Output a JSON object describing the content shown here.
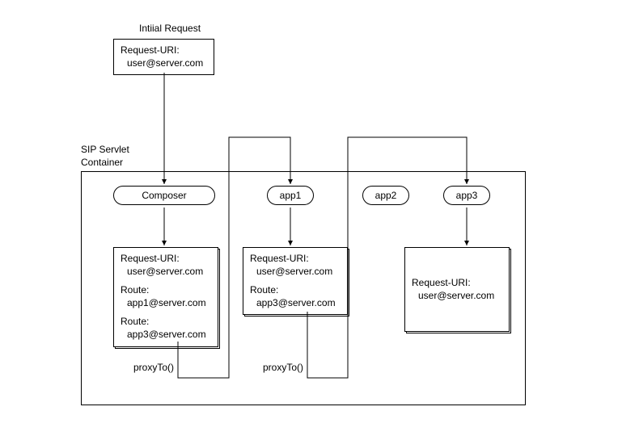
{
  "diagram": {
    "title_initial": "Intiial Request",
    "initial_box": {
      "line1": "Request-URI:",
      "line2": "user@server.com"
    },
    "container_label_line1": "SIP Servlet",
    "container_label_line2": "Container",
    "nodes": {
      "composer": "Composer",
      "app1": "app1",
      "app2": "app2",
      "app3": "app3"
    },
    "composer_box": {
      "l1": "Request-URI:",
      "l2": "user@server.com",
      "l3": "Route:",
      "l4": "app1@server.com",
      "l5": "Route:",
      "l6": "app3@server.com"
    },
    "app1_box": {
      "l1": "Request-URI:",
      "l2": "user@server.com",
      "l3": "Route:",
      "l4": "app3@server.com"
    },
    "app3_box": {
      "l1": "Request-URI:",
      "l2": "user@server.com"
    },
    "proxy_label": "proxyTo()"
  }
}
